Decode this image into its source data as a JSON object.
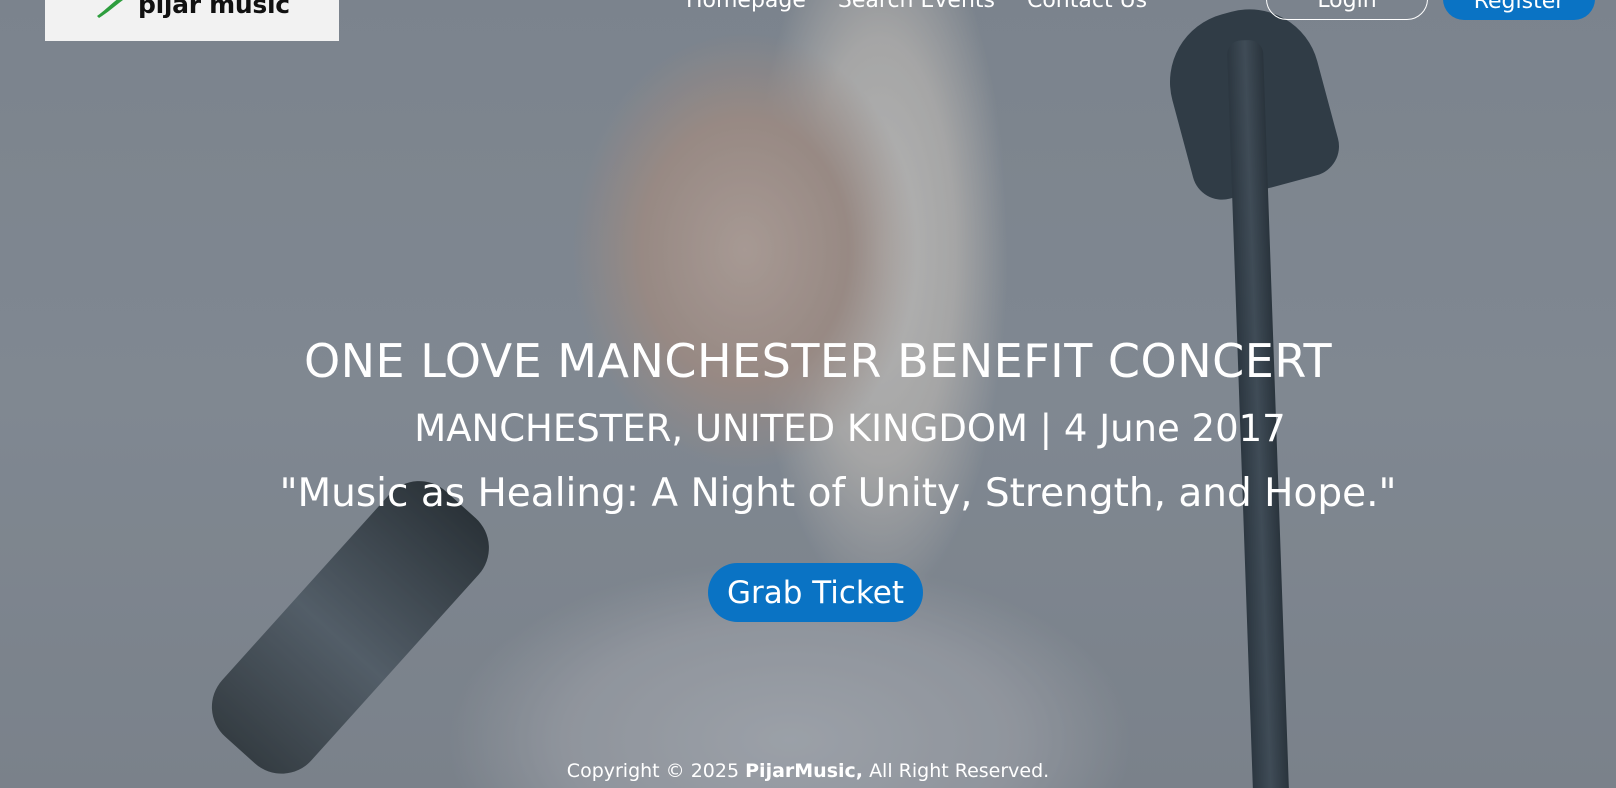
{
  "header": {
    "logo_text": "pijar music",
    "nav": [
      {
        "label": "Homepage"
      },
      {
        "label": "Search Events"
      },
      {
        "label": "Contact Us"
      }
    ],
    "login_label": "Login",
    "register_label": "Register"
  },
  "hero": {
    "title": "ONE LOVE MANCHESTER BENEFIT CONCERT",
    "location_date": "MANCHESTER, UNITED KINGDOM | 4 June 2017",
    "tagline": "\"Music as Healing: A Night of Unity, Strength, and Hope.\"",
    "cta_label": "Grab Ticket"
  },
  "footer": {
    "prefix": "Copyright © 2025",
    "brand": "PijarMusic,",
    "suffix": "All Right Reserved."
  },
  "colors": {
    "accent": "#0a73c4",
    "text": "#ffffff",
    "logo_bg": "#f2f2f2"
  }
}
